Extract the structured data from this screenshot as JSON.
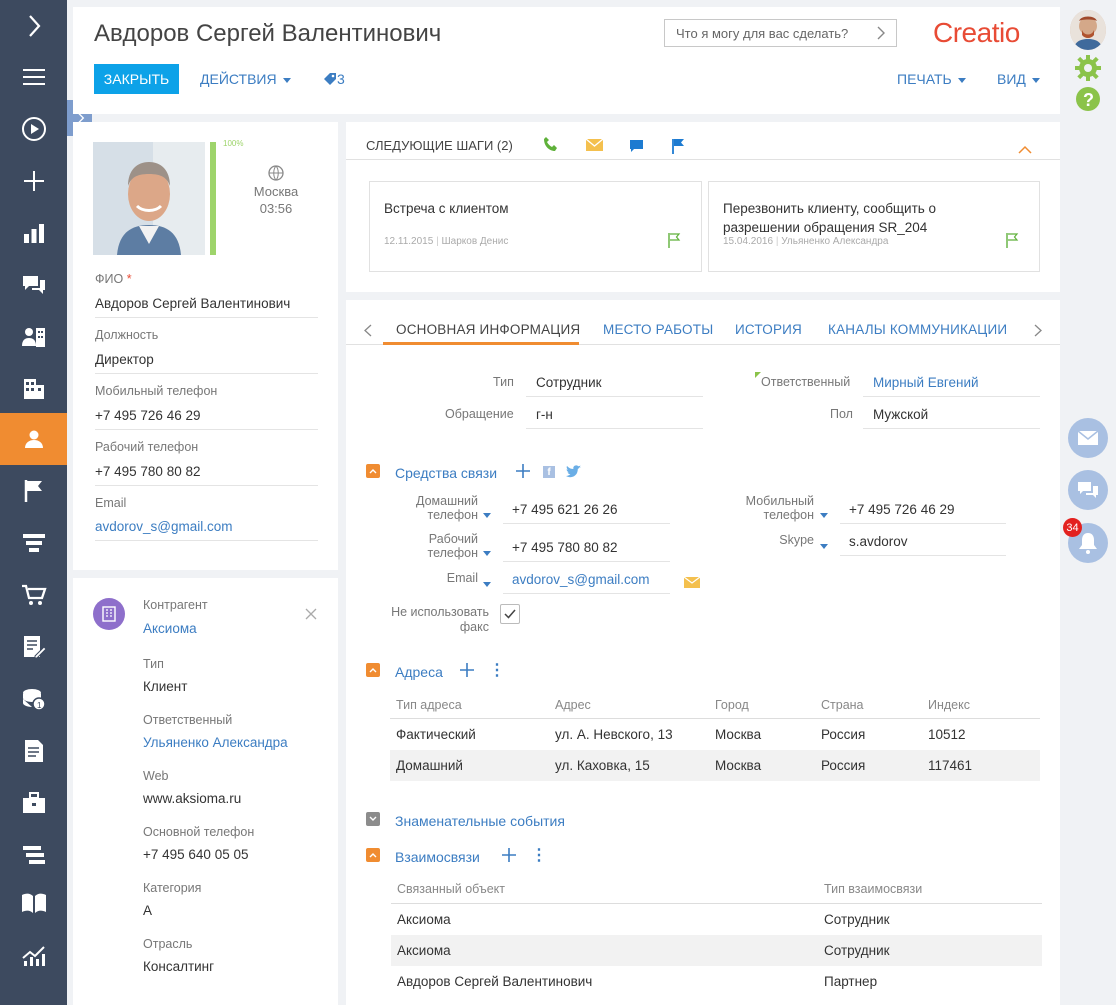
{
  "header": {
    "title": "Авдоров Сергей Валентинович",
    "close_label": "ЗАКРЫТЬ",
    "actions_label": "ДЕЙСТВИЯ",
    "tags_count": "3",
    "print_label": "ПЕЧАТЬ",
    "view_label": "ВИД",
    "search_placeholder": "Что я могу для вас сделать?",
    "logo_text": "Creatio"
  },
  "profile": {
    "completeness": "100%",
    "completeness_value": 1.0,
    "city": "Москва",
    "time": "03:56",
    "fields": [
      {
        "label": "ФИО",
        "value": "Авдоров Сергей Валентинович",
        "required": "*"
      },
      {
        "label": "Должность",
        "value": "Директор"
      },
      {
        "label": "Мобильный телефон",
        "value": "+7 495 726 46 29"
      },
      {
        "label": "Рабочий телефон",
        "value": "+7 495 780 80 82"
      },
      {
        "label": "Email",
        "value": "avdorov_s@gmail.com"
      }
    ]
  },
  "account": {
    "label": "Контрагент",
    "name": "Аксиома",
    "fields": [
      {
        "label": "Тип",
        "value": "Клиент"
      },
      {
        "label": "Ответственный",
        "value": "Ульяненко Александра"
      },
      {
        "label": "Web",
        "value": "www.aksioma.ru"
      },
      {
        "label": "Основной телефон",
        "value": "+7 495 640 05 05"
      },
      {
        "label": "Категория",
        "value": "A"
      },
      {
        "label": "Отрасль",
        "value": "Консалтинг"
      }
    ]
  },
  "next_steps": {
    "title": "СЛЕДУЮЩИЕ ШАГИ (2)",
    "items": [
      {
        "title": "Встреча с клиентом",
        "date": "12.11.2015",
        "owner": "Шарков Денис"
      },
      {
        "title": "Перезвонить клиенту, сообщить о разрешении обращения SR_204",
        "date": "15.04.2016",
        "owner": "Ульяненко Александра"
      }
    ]
  },
  "tabs": [
    {
      "label": "ОСНОВНАЯ ИНФОРМАЦИЯ"
    },
    {
      "label": "МЕСТО РАБОТЫ"
    },
    {
      "label": "ИСТОРИЯ"
    },
    {
      "label": "КАНАЛЫ КОММУНИКАЦИИ"
    }
  ],
  "main_info": {
    "type_label": "Тип",
    "type_value": "Сотрудник",
    "salutation_label": "Обращение",
    "salutation_value": "г-н",
    "owner_label": "Ответственный",
    "owner_value": "Мирный Евгений",
    "gender_label": "Пол",
    "gender_value": "Мужской"
  },
  "comm": {
    "title": "Средства связи",
    "home_label_1": "Домашний",
    "home_label_2": "телефон",
    "home_value": "+7 495 621 26 26",
    "work_label_1": "Рабочий",
    "work_label_2": "телефон",
    "work_value": "+7 495 780 80 82",
    "email_label": "Email",
    "email_value": "avdorov_s@gmail.com",
    "mobile_label_1": "Мобильный",
    "mobile_label_2": "телефон",
    "mobile_value": "+7 495 726 46 29",
    "skype_label": "Skype",
    "skype_value": "s.avdorov",
    "nofax_label_1": "Не использовать",
    "nofax_label_2": "факс"
  },
  "addresses": {
    "title": "Адреса",
    "columns": [
      "Тип адреса",
      "Адрес",
      "Город",
      "Страна",
      "Индекс"
    ],
    "rows": [
      [
        "Фактический",
        "ул. А. Невского, 13",
        "Москва",
        "Россия",
        "10512"
      ],
      [
        "Домашний",
        "ул. Каховка, 15",
        "Москва",
        "Россия",
        "117461"
      ]
    ]
  },
  "events": {
    "title": "Знаменательные события"
  },
  "relations": {
    "title": "Взаимосвязи",
    "columns": [
      "Связанный объект",
      "Тип взаимосвязи"
    ],
    "rows": [
      [
        "Аксиома",
        "Сотрудник"
      ],
      [
        "Аксиома",
        "Сотрудник"
      ],
      [
        "Авдоров Сергей Валентинович",
        "Партнер"
      ]
    ]
  },
  "notifications": {
    "count": "34"
  },
  "colors": {
    "accent": "#f08c31",
    "primary": "#0da2e8",
    "link": "#3c7dc2",
    "nav": "#3d4a5f"
  }
}
